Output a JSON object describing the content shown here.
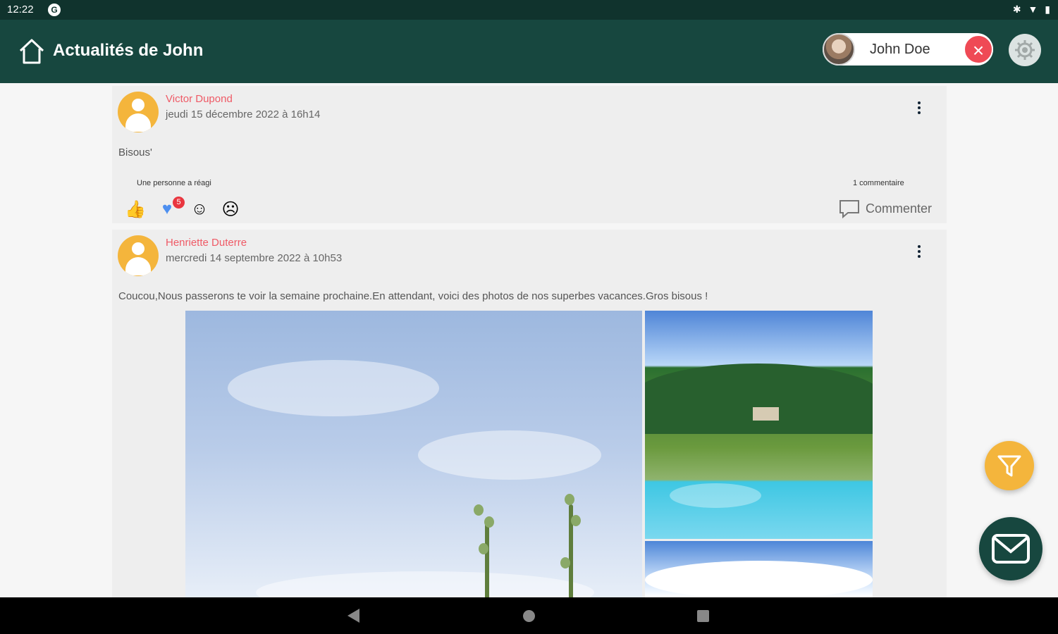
{
  "status_bar": {
    "time": "12:22",
    "app_icon": "G",
    "system_icons": [
      "bluetooth-icon",
      "wifi-icon",
      "battery-icon"
    ]
  },
  "appbar": {
    "title": "Actualités de John",
    "user_name": "John Doe",
    "background_color": "#17473f"
  },
  "posts": [
    {
      "author": "Victor Dupond",
      "date": "jeudi 15 décembre 2022 à 16h14",
      "text": "Bisous'",
      "reaction_summary": "Une personne a réagi",
      "comment_count": "1 commentaire",
      "heart_badge": "5",
      "comment_label": "Commenter"
    },
    {
      "author": "Henriette Duterre",
      "date": "mercredi 14 septembre 2022 à 10h53",
      "text": "Coucou,Nous passerons te voir la semaine prochaine.En attendant, voici des photos de nos superbes vacances.Gros bisous !"
    }
  ],
  "accent_colors": {
    "author": "#ef5a66",
    "avatar": "#f4b53c",
    "logout": "#ef4a55"
  }
}
